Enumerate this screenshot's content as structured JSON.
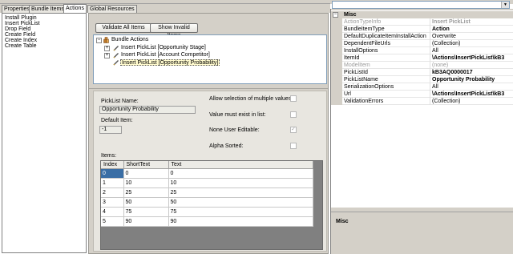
{
  "tabs": [
    "Properties",
    "Bundle Items",
    "Actions",
    "Global Resources"
  ],
  "active_tab": "Actions",
  "left_list": [
    "Install Plugin",
    "Insert PickList",
    "Drop Field",
    "Create Field",
    "Create Index",
    "Create Table"
  ],
  "toolbar": {
    "validate_all": "Validate All Items",
    "show_invalid": "Show Invalid Items"
  },
  "tree": {
    "root": "Bundle Actions",
    "children": [
      "Insert PickList [Opportunity Stage]",
      "Insert PickList [Account Competitor]",
      "Insert PickList [Opportunity Probability]"
    ]
  },
  "form": {
    "picklist_name_label": "PickList Name:",
    "picklist_name_value": "Opportunity Probability",
    "default_item_label": "Default Item:",
    "default_item_value": "-1",
    "allow_multiple_label": "Allow selection of multiple values:",
    "must_exist_label": "Value must exist in list:",
    "none_user_editable_label": "None User Editable:",
    "none_user_editable_mark": "✓",
    "alpha_sorted_label": "Alpha Sorted:",
    "items_label": "Items:"
  },
  "items_table": {
    "columns": [
      "Index",
      "ShortText",
      "Text"
    ],
    "rows": [
      [
        "0",
        "0",
        "0"
      ],
      [
        "1",
        "10",
        "10"
      ],
      [
        "2",
        "25",
        "25"
      ],
      [
        "3",
        "50",
        "50"
      ],
      [
        "4",
        "75",
        "75"
      ],
      [
        "5",
        "90",
        "90"
      ]
    ]
  },
  "properties": {
    "category": "Misc",
    "rows": [
      {
        "name": "ActionTypeInfo",
        "value": "Insert PickList"
      },
      {
        "name": "BundleItemType",
        "value": "Action"
      },
      {
        "name": "DefaultDuplicateItemInstallAction",
        "value": "Overwrite"
      },
      {
        "name": "DependentFileUrls",
        "value": "(Collection)"
      },
      {
        "name": "InstallOptions",
        "value": "All"
      },
      {
        "name": "ItemId",
        "value": "\\Actions\\InsertPickList\\kB3"
      },
      {
        "name": "ModelItem",
        "value": "(none)"
      },
      {
        "name": "PickListId",
        "value": "kB3AQ0000017"
      },
      {
        "name": "PickListName",
        "value": "Opportunity Probability"
      },
      {
        "name": "SerializationOptions",
        "value": "All"
      },
      {
        "name": "Url",
        "value": "\\Actions\\InsertPickList\\kB3"
      },
      {
        "name": "ValidationErrors",
        "value": "(Collection)"
      }
    ],
    "description_title": "Misc"
  },
  "icons": {
    "expand": "+",
    "collapse": "−",
    "dropdown": "▼"
  }
}
